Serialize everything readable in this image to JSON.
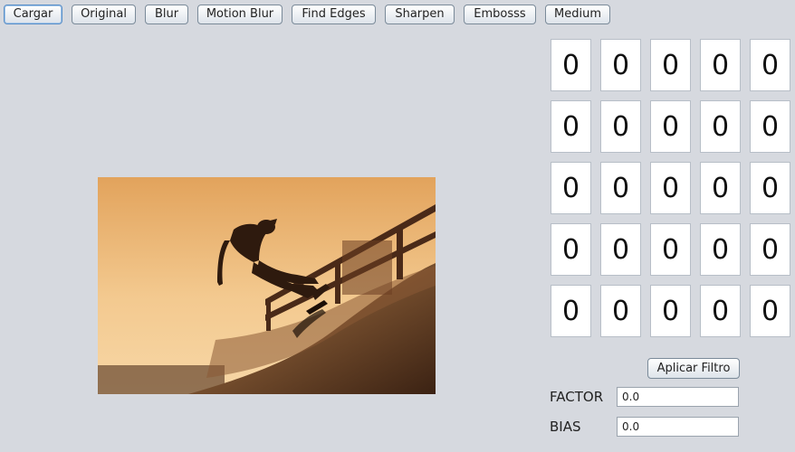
{
  "toolbar": {
    "buttons": [
      {
        "label": "Cargar"
      },
      {
        "label": "Original"
      },
      {
        "label": "Blur"
      },
      {
        "label": "Motion Blur"
      },
      {
        "label": "Find Edges"
      },
      {
        "label": "Sharpen"
      },
      {
        "label": "Embosss"
      },
      {
        "label": "Medium"
      }
    ]
  },
  "kernel": {
    "rows": [
      [
        "0",
        "0",
        "0",
        "0",
        "0"
      ],
      [
        "0",
        "0",
        "0",
        "0",
        "0"
      ],
      [
        "0",
        "0",
        "0",
        "0",
        "0"
      ],
      [
        "0",
        "0",
        "0",
        "0",
        "0"
      ],
      [
        "0",
        "0",
        "0",
        "0",
        "0"
      ]
    ]
  },
  "controls": {
    "apply_label": "Aplicar Filtro",
    "factor_label": "FACTOR",
    "factor_value": "0.0",
    "bias_label": "BIAS",
    "bias_value": "0.0"
  },
  "colors": {
    "background": "#d6d9df",
    "focus": "#5a8fc7"
  },
  "image": {
    "icon": "skateboarder-photo"
  }
}
